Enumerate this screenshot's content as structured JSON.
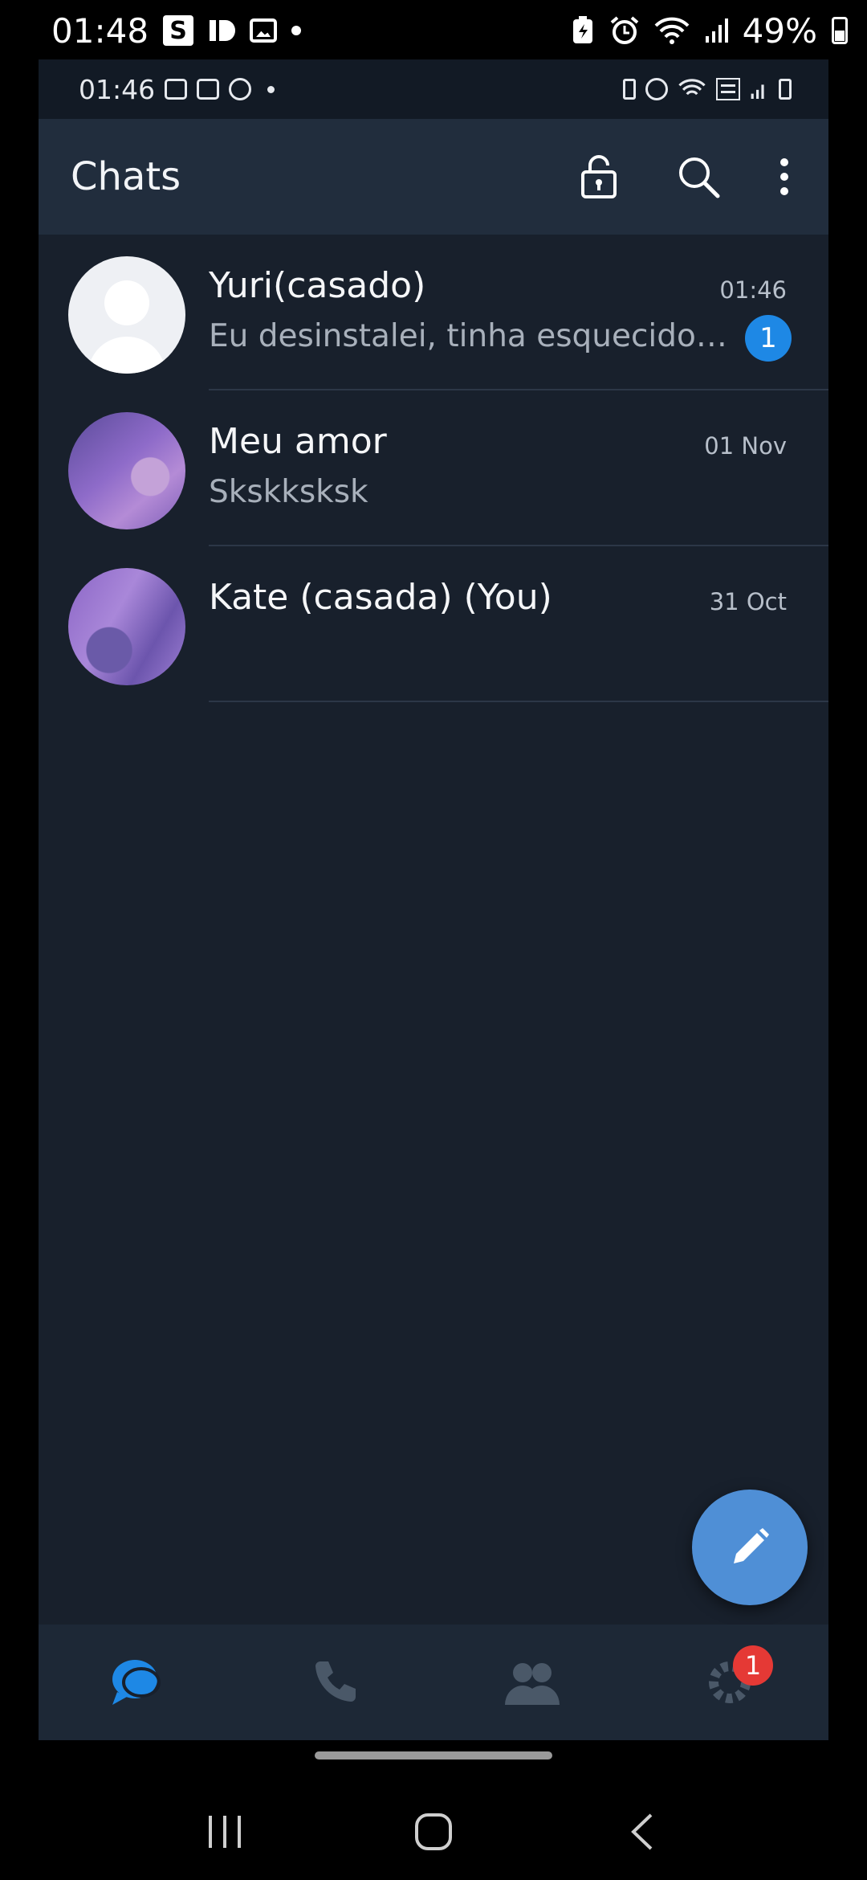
{
  "device_status": {
    "time": "01:48",
    "battery": "49%",
    "left_icons": [
      "s-app-icon",
      "id-app-icon",
      "gallery-icon",
      "notification-dot"
    ],
    "right_icons": [
      "battery-saver-icon",
      "alarm-icon",
      "wifi-icon",
      "signal-icon",
      "battery-icon"
    ]
  },
  "inner_status": {
    "time": "01:46",
    "icons": [
      "gallery-icon",
      "instagram-icon",
      "accessibility-icon",
      "notification-dot",
      "battery-saver-icon",
      "alarm-icon",
      "wifi-icon",
      "volte-icon",
      "signal-icon",
      "battery-icon"
    ]
  },
  "header": {
    "title": "Chats",
    "actions": [
      "lock-icon",
      "search-icon",
      "more-options-icon"
    ]
  },
  "chats": [
    {
      "name": "Yuri(casado)",
      "time": "01:46",
      "preview": "Eu desinstalei, tinha esquecido…",
      "unread": "1",
      "avatar": "default-avatar"
    },
    {
      "name": "Meu amor",
      "time": "01 Nov",
      "preview": "Skskksksk",
      "unread": "",
      "avatar": "photo-avatar"
    },
    {
      "name": "Kate (casada) (You)",
      "time": "31 Oct",
      "preview": "",
      "unread": "",
      "avatar": "photo-avatar"
    }
  ],
  "fab": {
    "icon": "pencil-icon"
  },
  "bottom_nav": [
    {
      "icon": "chats-icon",
      "active": true
    },
    {
      "icon": "phone-icon",
      "active": false
    },
    {
      "icon": "contacts-icon",
      "active": false
    },
    {
      "icon": "settings-icon",
      "active": false,
      "badge": "1"
    }
  ],
  "colors": {
    "background": "#18202c",
    "header": "#212d3d",
    "accent": "#1e88e5",
    "fab": "#4f8fd6",
    "badge": "#e53935"
  }
}
